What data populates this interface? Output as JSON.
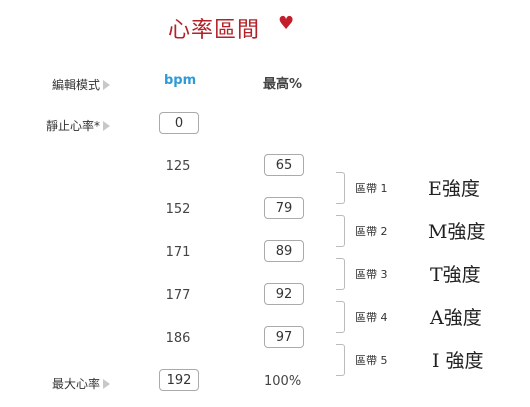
{
  "header": {
    "title": "心率區間",
    "heart_icon": "heart-icon"
  },
  "labels": {
    "edit_mode": "編輯模式",
    "resting_hr": "靜止心率*",
    "max_hr": "最大心率"
  },
  "columns": {
    "bpm": "bpm",
    "max_pct": "最高%"
  },
  "resting": {
    "value": "0"
  },
  "rows": [
    {
      "bpm": "125",
      "pct": "65"
    },
    {
      "bpm": "152",
      "pct": "79"
    },
    {
      "bpm": "171",
      "pct": "89"
    },
    {
      "bpm": "177",
      "pct": "92"
    },
    {
      "bpm": "186",
      "pct": "97"
    }
  ],
  "max": {
    "bpm": "192",
    "pct": "100%"
  },
  "zones": [
    {
      "label": "區帶 1",
      "intensity": "E強度"
    },
    {
      "label": "區帶 2",
      "intensity": "M強度"
    },
    {
      "label": "區帶 3",
      "intensity": "T強度"
    },
    {
      "label": "區帶 4",
      "intensity": "A強度"
    },
    {
      "label": "區帶 5",
      "intensity": "I 強度"
    }
  ],
  "colors": {
    "title": "#b22228",
    "bpm_header": "#2e9ad6",
    "heart": "#c41e2a"
  }
}
